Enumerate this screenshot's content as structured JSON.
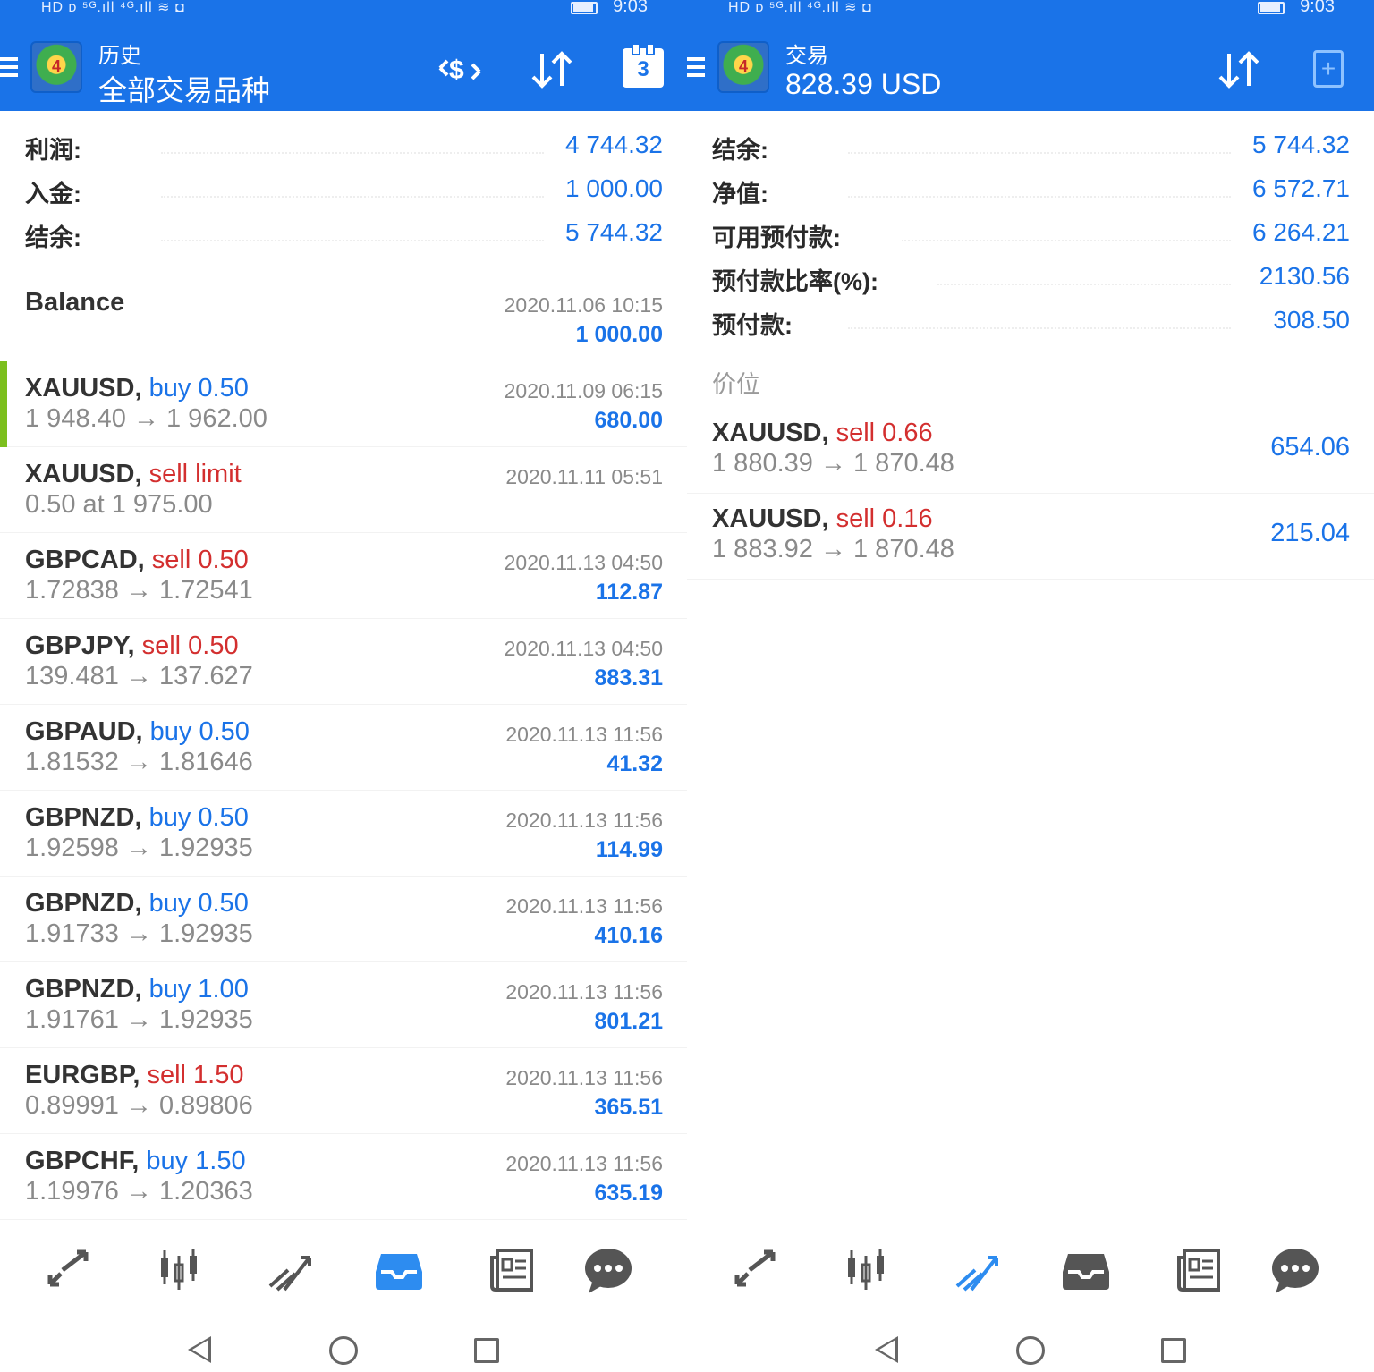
{
  "status_bar": {
    "network": "HD ᴅ ⁵ᴳ.ıll ⁴ᴳ.ıll ≋ ◘",
    "time": "9:03"
  },
  "colors": {
    "accent": "#1a73e8",
    "buy": "#1a73e8",
    "sell": "#d32f2f",
    "highlight": "#7cbf1e",
    "muted": "#8a8a8a"
  },
  "history": {
    "subtitle": "历史",
    "title": "全部交易品种",
    "toolbar": {
      "currency_icon": "currency-exchange-icon",
      "sort_icon": "sort-icon",
      "calendar_day": "3"
    },
    "summary": [
      {
        "label": "利润:",
        "value": "4 744.32"
      },
      {
        "label": "入金:",
        "value": "1 000.00"
      },
      {
        "label": "结余:",
        "value": "5 744.32"
      }
    ],
    "balance": {
      "title": "Balance",
      "date": "2020.11.06 10:15",
      "amount": "1 000.00"
    },
    "deals": [
      {
        "symbol": "XAUUSD,",
        "side": "buy",
        "side_text": "buy 0.50",
        "prices": "1 948.40 → 1 962.00",
        "date": "2020.11.09 06:15",
        "profit": "680.00",
        "highlight": true
      },
      {
        "symbol": "XAUUSD,",
        "side": "sell",
        "side_text": "sell limit",
        "prices": "0.50 at 1 975.00",
        "date": "2020.11.11 05:51",
        "profit": ""
      },
      {
        "symbol": "GBPCAD,",
        "side": "sell",
        "side_text": "sell 0.50",
        "prices": "1.72838 → 1.72541",
        "date": "2020.11.13 04:50",
        "profit": "112.87"
      },
      {
        "symbol": "GBPJPY,",
        "side": "sell",
        "side_text": "sell 0.50",
        "prices": "139.481 → 137.627",
        "date": "2020.11.13 04:50",
        "profit": "883.31"
      },
      {
        "symbol": "GBPAUD,",
        "side": "buy",
        "side_text": "buy 0.50",
        "prices": "1.81532 → 1.81646",
        "date": "2020.11.13 11:56",
        "profit": "41.32"
      },
      {
        "symbol": "GBPNZD,",
        "side": "buy",
        "side_text": "buy 0.50",
        "prices": "1.92598 → 1.92935",
        "date": "2020.11.13 11:56",
        "profit": "114.99"
      },
      {
        "symbol": "GBPNZD,",
        "side": "buy",
        "side_text": "buy 0.50",
        "prices": "1.91733 → 1.92935",
        "date": "2020.11.13 11:56",
        "profit": "410.16"
      },
      {
        "symbol": "GBPNZD,",
        "side": "buy",
        "side_text": "buy 1.00",
        "prices": "1.91761 → 1.92935",
        "date": "2020.11.13 11:56",
        "profit": "801.21"
      },
      {
        "symbol": "EURGBP,",
        "side": "sell",
        "side_text": "sell 1.50",
        "prices": "0.89991 → 0.89806",
        "date": "2020.11.13 11:56",
        "profit": "365.51"
      },
      {
        "symbol": "GBPCHF,",
        "side": "buy",
        "side_text": "buy 1.50",
        "prices": "1.19976 → 1.20363",
        "date": "2020.11.13 11:56",
        "profit": "635.19"
      }
    ]
  },
  "trade": {
    "subtitle": "交易",
    "title": "828.39 USD",
    "toolbar": {
      "sort_icon": "sort-icon",
      "new_order_icon": "new-order-icon"
    },
    "summary": [
      {
        "label": "结余:",
        "value": "5 744.32"
      },
      {
        "label": "净值:",
        "value": "6 572.71"
      },
      {
        "label": "可用预付款:",
        "value": "6 264.21"
      },
      {
        "label": "预付款比率(%):",
        "value": "2130.56"
      },
      {
        "label": "预付款:",
        "value": "308.50"
      }
    ],
    "section_label": "价位",
    "positions": [
      {
        "symbol": "XAUUSD,",
        "side_text": "sell 0.66",
        "prices": "1 880.39 → 1 870.48",
        "profit": "654.06"
      },
      {
        "symbol": "XAUUSD,",
        "side_text": "sell 0.16",
        "prices": "1 883.92 → 1 870.48",
        "profit": "215.04"
      }
    ]
  },
  "bottom_nav": [
    {
      "name": "quotes-icon",
      "glyph": "⇄"
    },
    {
      "name": "chart-candles-icon",
      "glyph": "╫"
    },
    {
      "name": "trade-icon",
      "glyph": "⟋"
    },
    {
      "name": "history-icon",
      "glyph": "▣"
    },
    {
      "name": "news-icon",
      "glyph": "▤"
    },
    {
      "name": "messages-icon",
      "glyph": "●"
    }
  ],
  "bottom_nav_active": {
    "left": "history-icon",
    "right": "trade-icon"
  }
}
